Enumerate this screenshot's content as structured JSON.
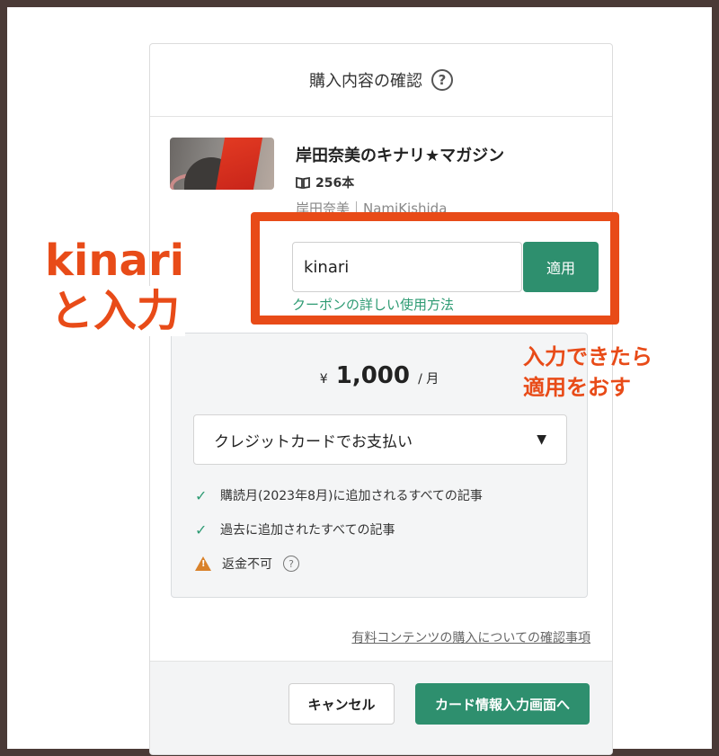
{
  "header": {
    "title": "購入内容の確認",
    "help_icon": "?"
  },
  "product": {
    "title": "岸田奈美のキナリ★マガジン",
    "count": "256本",
    "author": "岸田奈美｜NamiKishida"
  },
  "coupon": {
    "value": "kinari",
    "apply_label": "適用",
    "link_label": "クーポンの詳しい使用方法"
  },
  "annotations": {
    "left_line1": "kinari",
    "left_line2": "と入力",
    "right_line1": "入力できたら",
    "right_line2": "適用をおす",
    "accent_color": "#e84b18"
  },
  "price": {
    "currency": "¥",
    "amount": "1,000",
    "period": "/ 月"
  },
  "payment": {
    "selected": "クレジットカードでお支払い"
  },
  "features": [
    {
      "icon": "check-icon",
      "text": "購読月(2023年8月)に追加されるすべての記事"
    },
    {
      "icon": "check-icon",
      "text": "過去に追加されたすべての記事"
    },
    {
      "icon": "warning-icon",
      "text": "返金不可"
    }
  ],
  "terms_link": "有料コンテンツの購入についての確認事項",
  "footer": {
    "cancel_label": "キャンセル",
    "next_label": "カード情報入力画面へ"
  },
  "colors": {
    "brand_green": "#2e8f6e",
    "link_green": "#2e9b73",
    "warning": "#d9822b"
  }
}
